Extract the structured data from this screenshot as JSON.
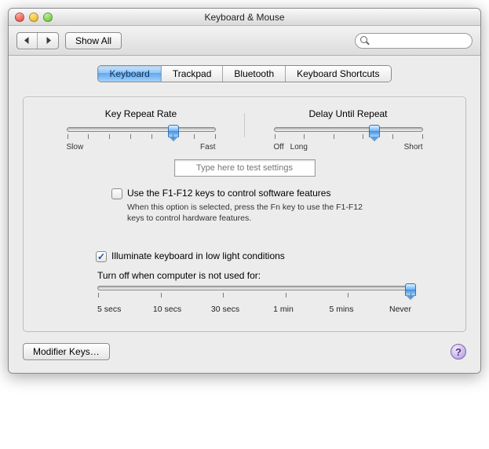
{
  "window": {
    "title": "Keyboard & Mouse"
  },
  "toolbar": {
    "show_all": "Show All",
    "search_placeholder": ""
  },
  "tabs": [
    {
      "label": "Keyboard",
      "selected": true
    },
    {
      "label": "Trackpad",
      "selected": false
    },
    {
      "label": "Bluetooth",
      "selected": false
    },
    {
      "label": "Keyboard Shortcuts",
      "selected": false
    }
  ],
  "key_repeat": {
    "title": "Key Repeat Rate",
    "min_label": "Slow",
    "max_label": "Fast",
    "value_pct": 72,
    "ticks": 8
  },
  "delay_repeat": {
    "title": "Delay Until Repeat",
    "off_label": "Off",
    "min_label": "Long",
    "max_label": "Short",
    "value_pct": 68,
    "ticks": 6
  },
  "test_field": {
    "placeholder": "Type here to test settings"
  },
  "fn_keys": {
    "checked": false,
    "label": "Use the F1-F12 keys to control software features",
    "sub": "When this option is selected, press the Fn key to use the F1-F12 keys to control hardware features."
  },
  "illumination": {
    "checked": true,
    "label": "Illuminate keyboard in low light conditions",
    "sub": "Turn off when computer is not used for:",
    "value_pct": 100,
    "scale": [
      "5 secs",
      "10 secs",
      "30 secs",
      "1 min",
      "5 mins",
      "Never"
    ],
    "ticks": 6
  },
  "buttons": {
    "modifier_keys": "Modifier Keys…",
    "help": "?"
  }
}
